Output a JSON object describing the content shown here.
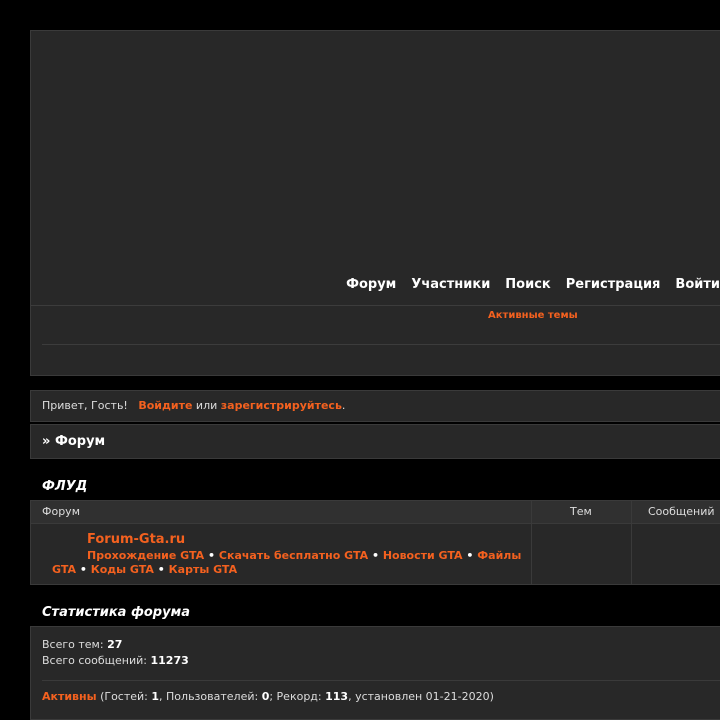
{
  "nav": {
    "items": [
      "Форум",
      "Участники",
      "Поиск",
      "Регистрация",
      "Войти"
    ],
    "active_topics": "Активные темы"
  },
  "greeting": {
    "hello": "Привет, Гость!",
    "login": "Войдите",
    "or": "или",
    "register": "зарегистрируйтесь",
    "end": "."
  },
  "breadcrumb": {
    "prefix": "»",
    "label": "Форум"
  },
  "category": {
    "title": "ФЛУД",
    "columns": [
      "Форум",
      "Тем",
      "Сообщений"
    ],
    "forum_name": "Forum-Gta.ru",
    "links": [
      "Прохождение GTA",
      "Скачать бесплатно GTA",
      "Новости GTA",
      "Файлы GTA",
      "Коды GTA",
      "Карты GTA"
    ],
    "link_separator": "•"
  },
  "stats": {
    "title": "Статистика форума",
    "topics_label": "Всего тем:",
    "topics_value": "27",
    "posts_label": "Всего сообщений:",
    "posts_value": "11273",
    "active_label": "Активны",
    "guests_label": "(Гостей:",
    "guests_value": "1",
    "users_label": ", Пользователей:",
    "users_value": "0",
    "record_label": "; Рекорд:",
    "record_value": "113",
    "record_date": ", установлен 01-21-2020)"
  },
  "colors": {
    "accent": "#f4611f",
    "panel": "#282828",
    "background": "#000000"
  }
}
